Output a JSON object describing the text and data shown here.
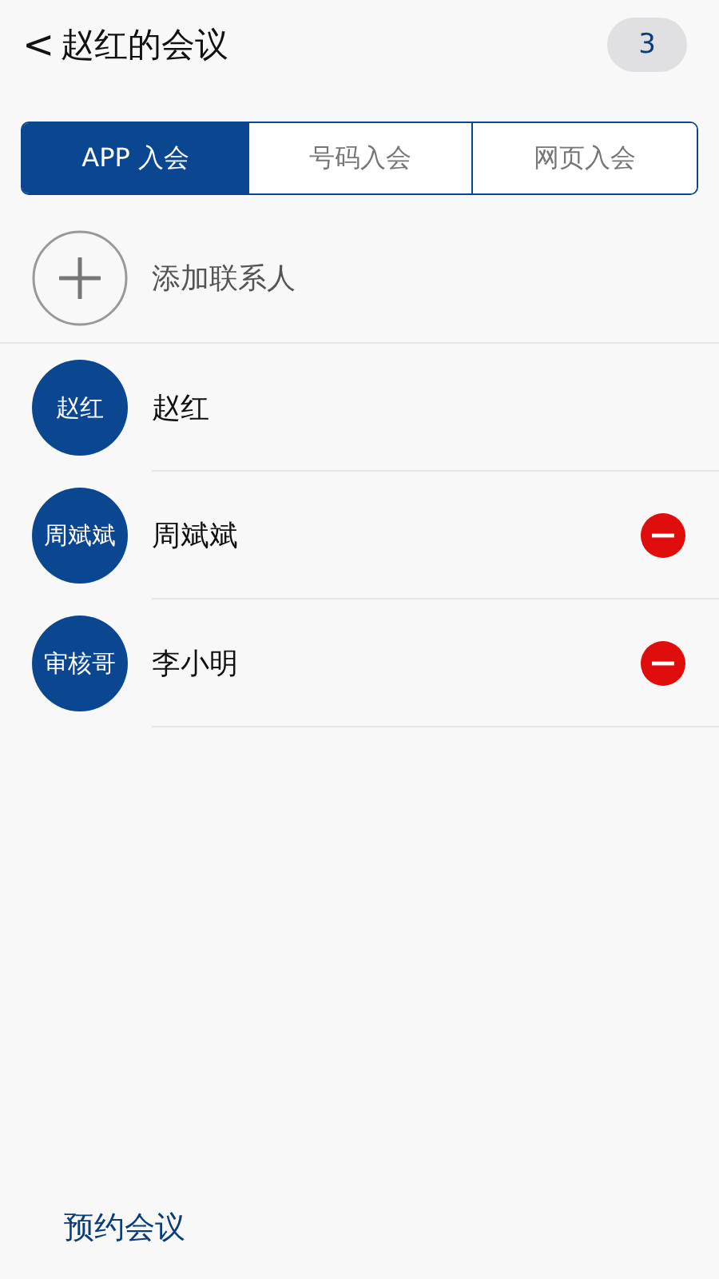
{
  "header": {
    "back": "<",
    "title": "赵红的会议",
    "count": "3"
  },
  "tabs": [
    {
      "label": "APP 入会",
      "selected": true
    },
    {
      "label": "号码入会",
      "selected": false
    },
    {
      "label": "网页入会",
      "selected": false
    }
  ],
  "add_contact": {
    "label": "添加联系人"
  },
  "members": [
    {
      "avatar": "赵红",
      "name": "赵红",
      "removable": false
    },
    {
      "avatar": "周斌斌",
      "name": "周斌斌",
      "removable": true
    },
    {
      "avatar": "审核哥",
      "name": "李小明",
      "removable": true
    }
  ],
  "footer": {
    "link": "预约会议"
  }
}
